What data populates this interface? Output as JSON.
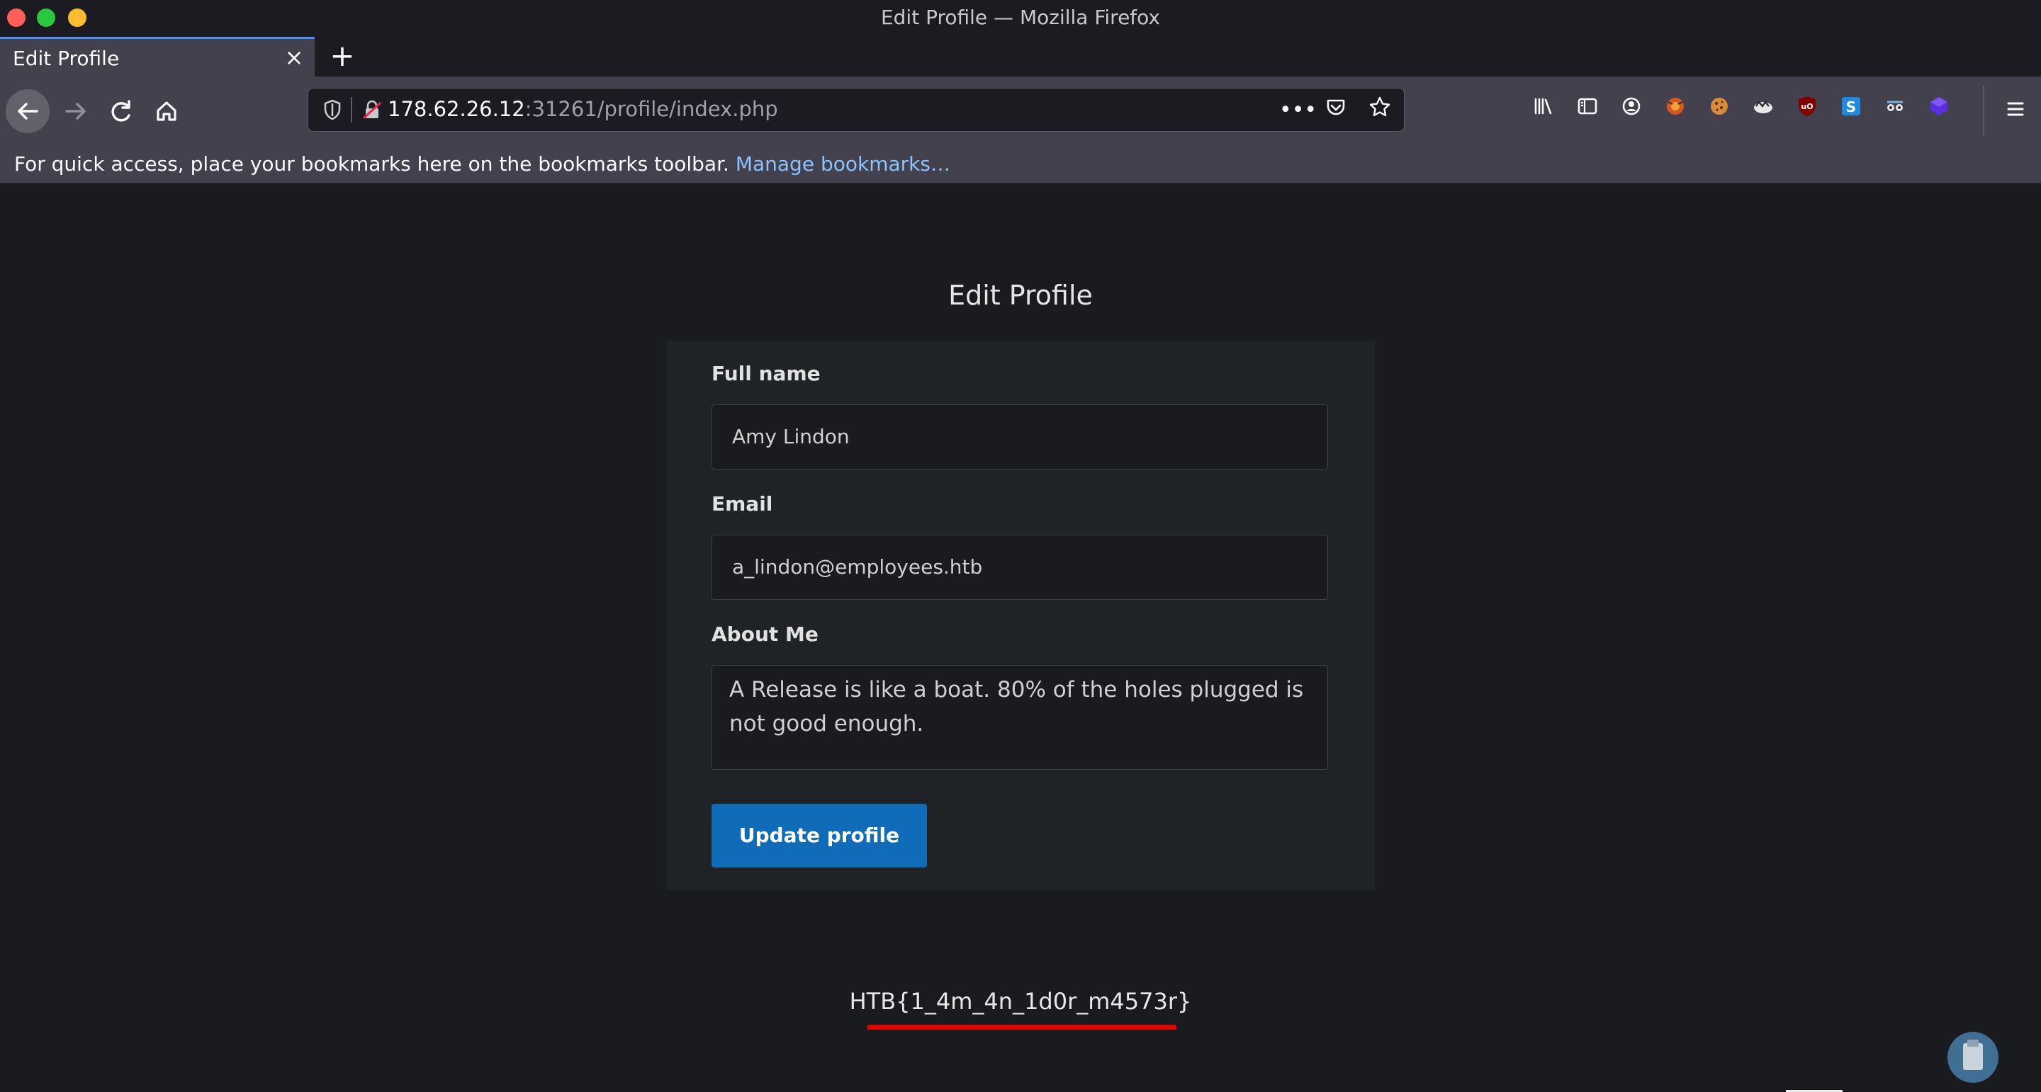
{
  "window": {
    "title": "Edit Profile — Mozilla Firefox"
  },
  "tab": {
    "label": "Edit Profile",
    "close": "×",
    "new_tab": "+"
  },
  "navbar": {
    "url_host": "178.62.26.12",
    "url_rest": ":31261/profile/index.php",
    "more_icon": "•••"
  },
  "bookmarks": {
    "text": "For quick access, place your bookmarks here on the bookmarks toolbar.",
    "link": "Manage bookmarks…"
  },
  "page": {
    "title": "Edit Profile",
    "full_name_label": "Full name",
    "full_name_value": "Amy Lindon",
    "email_label": "Email",
    "email_value": "a_lindon@employees.htb",
    "about_label": "About Me",
    "about_value": "A Release is like a boat. 80% of the holes plugged is not good enough.",
    "update_button": "Update profile",
    "flag": "HTB{1_4m_4n_1d0r_m4573r}"
  },
  "colors": {
    "accent": "#106bb8",
    "underline": "#e20000",
    "tab_highlight": "#4a8ff7"
  }
}
